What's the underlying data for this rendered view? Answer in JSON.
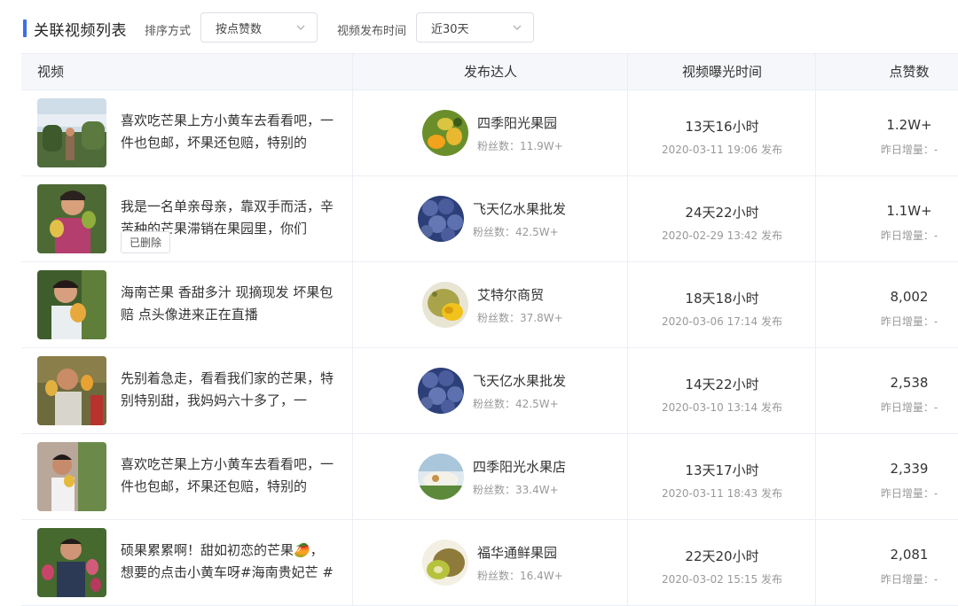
{
  "header": {
    "title": "关联视频列表",
    "sort_label": "排序方式",
    "sort_value": "按点赞数",
    "time_label": "视频发布时间",
    "time_value": "近30天"
  },
  "columns": {
    "video": "视频",
    "creator": "发布达人",
    "exposure": "视频曝光时间",
    "likes": "点赞数"
  },
  "rows": [
    {
      "title": "喜欢吃芒果上方小黄车去看看吧，一件也包邮，坏果还包赔，特别的",
      "deleted": "",
      "creator": "四季阳光果园",
      "fans": "粉丝数：11.9W+",
      "duration": "13天16小时",
      "published": "2020-03-11 19:06 发布",
      "likes": "1.2W+",
      "yesterday": "昨日增量：-"
    },
    {
      "title": "我是一名单亲母亲，靠双手而活，辛苦种的芒果滞销在果园里，你们",
      "deleted": "已删除",
      "creator": "飞天亿水果批发",
      "fans": "粉丝数：42.5W+",
      "duration": "24天22小时",
      "published": "2020-02-29 13:42 发布",
      "likes": "1.1W+",
      "yesterday": "昨日增量：-"
    },
    {
      "title": "海南芒果 香甜多汁 现摘现发 坏果包赔 点头像进来正在直播",
      "deleted": "",
      "creator": "艾特尔商贸",
      "fans": "粉丝数：37.8W+",
      "duration": "18天18小时",
      "published": "2020-03-06 17:14 发布",
      "likes": "8,002",
      "yesterday": "昨日增量：-"
    },
    {
      "title": "先别着急走，看看我们家的芒果，特别特别甜，我妈妈六十多了，一",
      "deleted": "",
      "creator": "飞天亿水果批发",
      "fans": "粉丝数：42.5W+",
      "duration": "14天22小时",
      "published": "2020-03-10 13:14 发布",
      "likes": "2,538",
      "yesterday": "昨日增量：-"
    },
    {
      "title": "喜欢吃芒果上方小黄车去看看吧，一件也包邮，坏果还包赔，特别的",
      "deleted": "",
      "creator": "四季阳光水果店",
      "fans": "粉丝数：33.4W+",
      "duration": "13天17小时",
      "published": "2020-03-11 18:43 发布",
      "likes": "2,339",
      "yesterday": "昨日增量：-"
    },
    {
      "title": "硕果累累啊！甜如初恋的芒果🥭，想要的点击小黄车呀#海南贵妃芒 #",
      "deleted": "",
      "creator": "福华通鲜果园",
      "fans": "粉丝数：16.4W+",
      "duration": "22天20小时",
      "published": "2020-03-02 15:15 发布",
      "likes": "2,081",
      "yesterday": "昨日增量：-"
    }
  ],
  "colors": {
    "accent": "#3d6fe5",
    "header_bg": "#f5f7fa",
    "border": "#ebeef5",
    "muted": "#999999"
  }
}
